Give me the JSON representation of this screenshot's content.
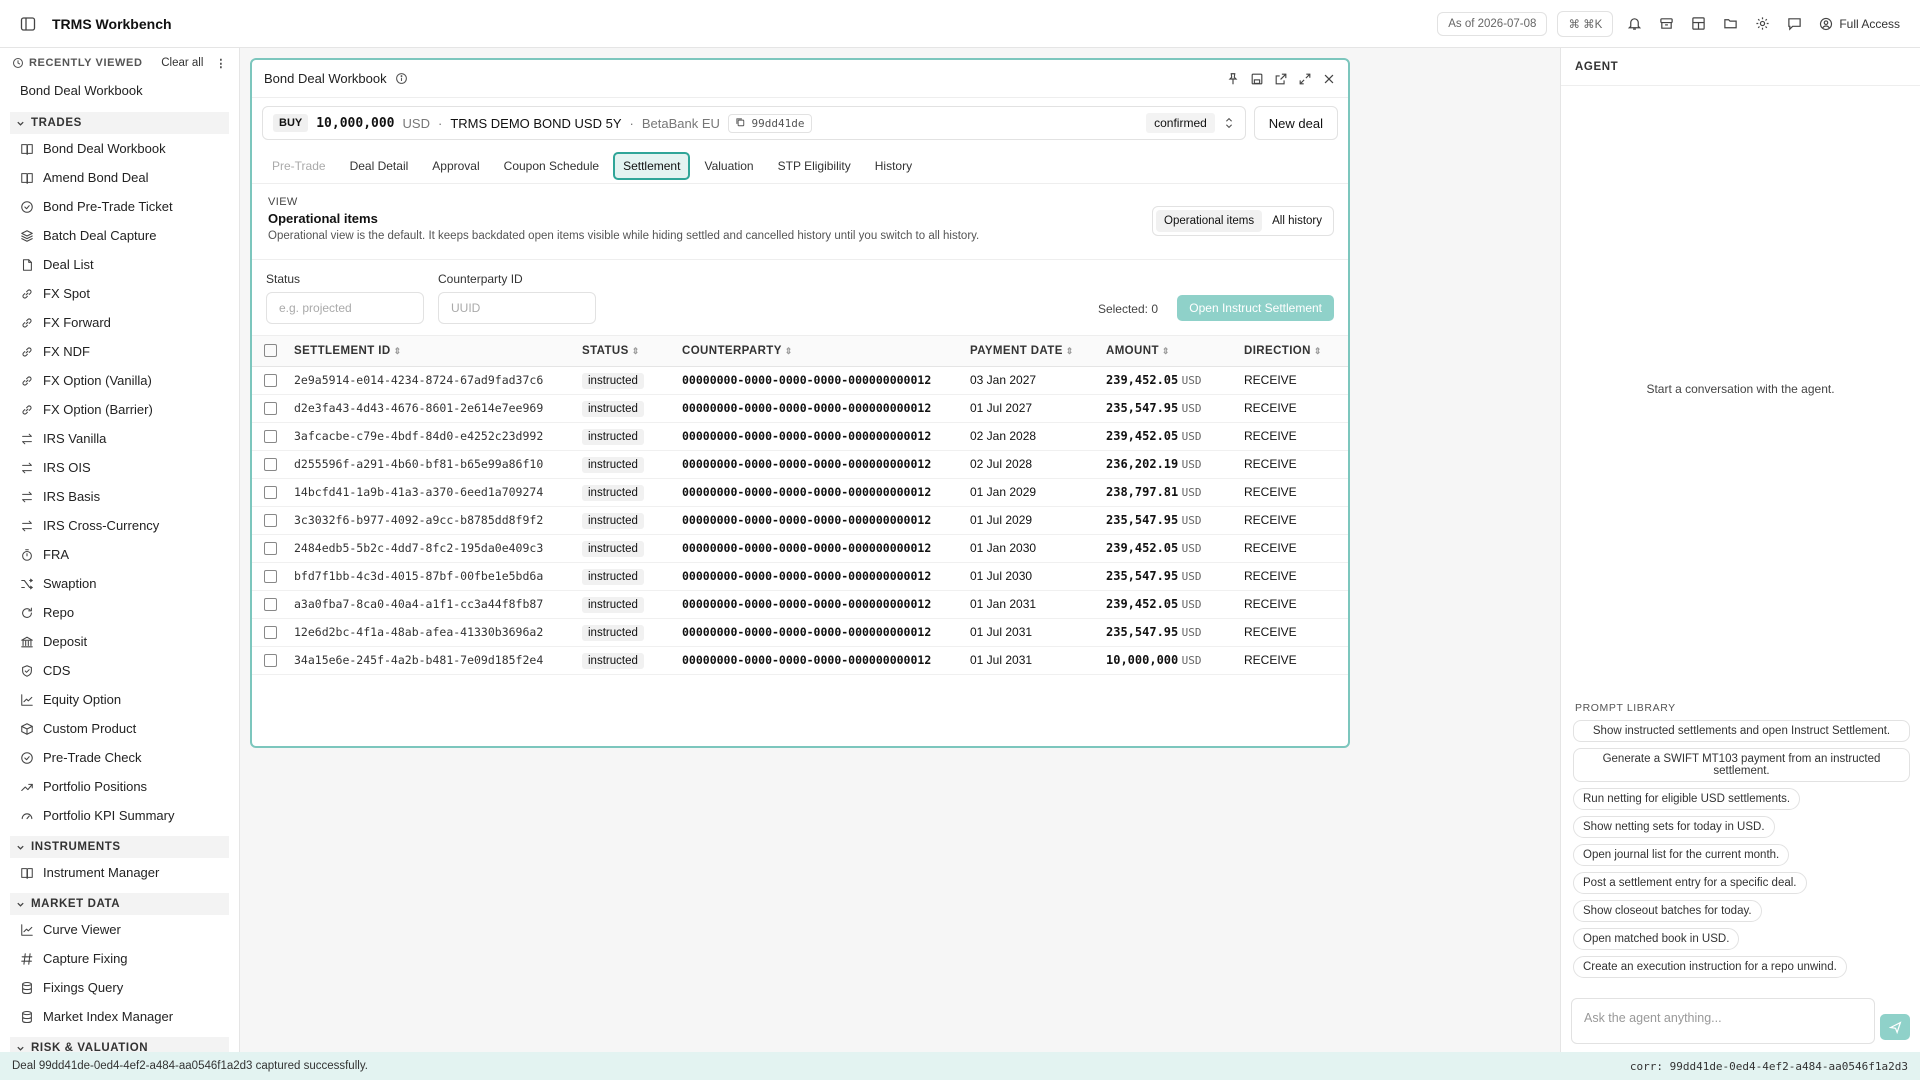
{
  "app": {
    "title": "TRMS Workbench"
  },
  "topbar": {
    "as_of": "As of 2026-07-08",
    "shortcut": "⌘ ⌘K",
    "access": "Full Access"
  },
  "sidebar": {
    "recently_viewed_label": "RECENTLY VIEWED",
    "clear_all": "Clear all",
    "recent": [
      "Bond Deal Workbook"
    ],
    "sections": [
      {
        "label": "TRADES",
        "items": [
          {
            "label": "Bond Deal Workbook",
            "icon": "book-icon"
          },
          {
            "label": "Amend Bond Deal",
            "icon": "book-icon"
          },
          {
            "label": "Bond Pre-Trade Ticket",
            "icon": "check-circle-icon"
          },
          {
            "label": "Batch Deal Capture",
            "icon": "layers-icon"
          },
          {
            "label": "Deal List",
            "icon": "document-icon"
          },
          {
            "label": "FX Spot",
            "icon": "link-icon"
          },
          {
            "label": "FX Forward",
            "icon": "link-icon"
          },
          {
            "label": "FX NDF",
            "icon": "link-icon"
          },
          {
            "label": "FX Option (Vanilla)",
            "icon": "link-icon"
          },
          {
            "label": "FX Option (Barrier)",
            "icon": "link-icon"
          },
          {
            "label": "IRS Vanilla",
            "icon": "swap-icon"
          },
          {
            "label": "IRS OIS",
            "icon": "swap-icon"
          },
          {
            "label": "IRS Basis",
            "icon": "swap-icon"
          },
          {
            "label": "IRS Cross-Currency",
            "icon": "swap-icon"
          },
          {
            "label": "FRA",
            "icon": "timer-icon"
          },
          {
            "label": "Swaption",
            "icon": "shuffle-icon"
          },
          {
            "label": "Repo",
            "icon": "refresh-icon"
          },
          {
            "label": "Deposit",
            "icon": "bank-icon"
          },
          {
            "label": "CDS",
            "icon": "shield-icon"
          },
          {
            "label": "Equity Option",
            "icon": "chart-line-icon"
          },
          {
            "label": "Custom Product",
            "icon": "box-icon"
          },
          {
            "label": "Pre-Trade Check",
            "icon": "check-circle-icon"
          },
          {
            "label": "Portfolio Positions",
            "icon": "trend-icon"
          },
          {
            "label": "Portfolio KPI Summary",
            "icon": "gauge-icon"
          }
        ]
      },
      {
        "label": "INSTRUMENTS",
        "items": [
          {
            "label": "Instrument Manager",
            "icon": "book-icon"
          }
        ]
      },
      {
        "label": "MARKET DATA",
        "items": [
          {
            "label": "Curve Viewer",
            "icon": "chart-line-icon"
          },
          {
            "label": "Capture Fixing",
            "icon": "hash-icon"
          },
          {
            "label": "Fixings Query",
            "icon": "database-icon"
          },
          {
            "label": "Market Index Manager",
            "icon": "database-icon"
          }
        ]
      },
      {
        "label": "RISK & VALUATION",
        "items": []
      }
    ]
  },
  "panel": {
    "title": "Bond Deal Workbook",
    "deal": {
      "side": "BUY",
      "amount": "10,000,000",
      "currency": "USD",
      "instrument": "TRMS DEMO BOND USD 5Y",
      "counterparty": "BetaBank EU",
      "id": "99dd41de",
      "status": "confirmed"
    },
    "new_deal": "New deal",
    "tabs": [
      "Pre-Trade",
      "Deal Detail",
      "Approval",
      "Coupon Schedule",
      "Settlement",
      "Valuation",
      "STP Eligibility",
      "History"
    ],
    "active_tab": "Settlement",
    "view": {
      "label": "VIEW",
      "heading": "Operational items",
      "description": "Operational view is the default. It keeps backdated open items visible while hiding settled and cancelled history until you switch to all history.",
      "options": [
        "Operational items",
        "All history"
      ]
    },
    "filters": {
      "status_label": "Status",
      "status_placeholder": "e.g. projected",
      "cpty_label": "Counterparty ID",
      "cpty_placeholder": "UUID"
    },
    "selected": "Selected: 0",
    "instruct_button": "Open Instruct Settlement",
    "table": {
      "columns": [
        "SETTLEMENT ID",
        "STATUS",
        "COUNTERPARTY",
        "PAYMENT DATE",
        "AMOUNT",
        "DIRECTION"
      ],
      "rows": [
        {
          "id": "2e9a5914-e014-4234-8724-67ad9fad37c6",
          "status": "instructed",
          "cpty": "00000000-0000-0000-0000-000000000012",
          "date": "03 Jan 2027",
          "amount": "239,452.05",
          "ccy": "USD",
          "dir": "RECEIVE"
        },
        {
          "id": "d2e3fa43-4d43-4676-8601-2e614e7ee969",
          "status": "instructed",
          "cpty": "00000000-0000-0000-0000-000000000012",
          "date": "01 Jul 2027",
          "amount": "235,547.95",
          "ccy": "USD",
          "dir": "RECEIVE"
        },
        {
          "id": "3afcacbe-c79e-4bdf-84d0-e4252c23d992",
          "status": "instructed",
          "cpty": "00000000-0000-0000-0000-000000000012",
          "date": "02 Jan 2028",
          "amount": "239,452.05",
          "ccy": "USD",
          "dir": "RECEIVE"
        },
        {
          "id": "d255596f-a291-4b60-bf81-b65e99a86f10",
          "status": "instructed",
          "cpty": "00000000-0000-0000-0000-000000000012",
          "date": "02 Jul 2028",
          "amount": "236,202.19",
          "ccy": "USD",
          "dir": "RECEIVE"
        },
        {
          "id": "14bcfd41-1a9b-41a3-a370-6eed1a709274",
          "status": "instructed",
          "cpty": "00000000-0000-0000-0000-000000000012",
          "date": "01 Jan 2029",
          "amount": "238,797.81",
          "ccy": "USD",
          "dir": "RECEIVE"
        },
        {
          "id": "3c3032f6-b977-4092-a9cc-b8785dd8f9f2",
          "status": "instructed",
          "cpty": "00000000-0000-0000-0000-000000000012",
          "date": "01 Jul 2029",
          "amount": "235,547.95",
          "ccy": "USD",
          "dir": "RECEIVE"
        },
        {
          "id": "2484edb5-5b2c-4dd7-8fc2-195da0e409c3",
          "status": "instructed",
          "cpty": "00000000-0000-0000-0000-000000000012",
          "date": "01 Jan 2030",
          "amount": "239,452.05",
          "ccy": "USD",
          "dir": "RECEIVE"
        },
        {
          "id": "bfd7f1bb-4c3d-4015-87bf-00fbe1e5bd6a",
          "status": "instructed",
          "cpty": "00000000-0000-0000-0000-000000000012",
          "date": "01 Jul 2030",
          "amount": "235,547.95",
          "ccy": "USD",
          "dir": "RECEIVE"
        },
        {
          "id": "a3a0fba7-8ca0-40a4-a1f1-cc3a44f8fb87",
          "status": "instructed",
          "cpty": "00000000-0000-0000-0000-000000000012",
          "date": "01 Jan 2031",
          "amount": "239,452.05",
          "ccy": "USD",
          "dir": "RECEIVE"
        },
        {
          "id": "12e6d2bc-4f1a-48ab-afea-41330b3696a2",
          "status": "instructed",
          "cpty": "00000000-0000-0000-0000-000000000012",
          "date": "01 Jul 2031",
          "amount": "235,547.95",
          "ccy": "USD",
          "dir": "RECEIVE"
        },
        {
          "id": "34a15e6e-245f-4a2b-b481-7e09d185f2e4",
          "status": "instructed",
          "cpty": "00000000-0000-0000-0000-000000000012",
          "date": "01 Jul 2031",
          "amount": "10,000,000",
          "ccy": "USD",
          "dir": "RECEIVE"
        }
      ]
    }
  },
  "agent": {
    "title": "AGENT",
    "empty": "Start a conversation with the agent.",
    "library_label": "PROMPT LIBRARY",
    "prompts": [
      "Show instructed settlements and open Instruct Settlement.",
      "Generate a SWIFT MT103 payment from an instructed settlement.",
      "Run netting for eligible USD settlements.",
      "Show netting sets for today in USD.",
      "Open journal list for the current month.",
      "Post a settlement entry for a specific deal.",
      "Show closeout batches for today.",
      "Open matched book in USD.",
      "Create an execution instruction for a repo unwind."
    ],
    "input_placeholder": "Ask the agent anything..."
  },
  "footer": {
    "message": "Deal 99dd41de-0ed4-4ef2-a484-aa0546f1a2d3 captured successfully.",
    "corr": "corr: 99dd41de-0ed4-4ef2-a484-aa0546f1a2d3"
  },
  "colors": {
    "accent": "#2fa598",
    "accent_light": "#8fd1c9",
    "footer_bg": "#e3f3f1"
  }
}
